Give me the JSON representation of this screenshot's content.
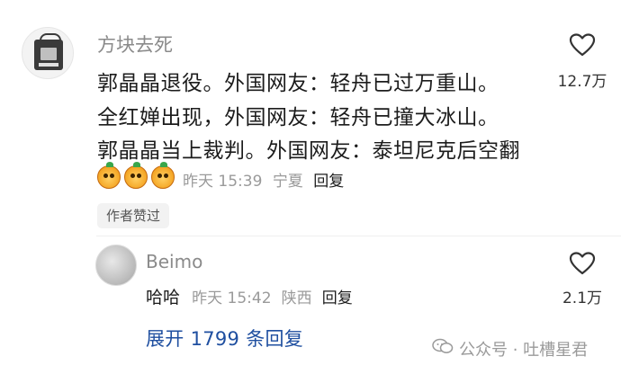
{
  "comment": {
    "username": "方块去死",
    "lines": [
      "郭晶晶退役。外国网友：轻舟已过万重山。",
      "全红婵出现，外国网友：轻舟已撞大冰山。",
      "郭晶晶当上裁判。外国网友：泰坦尼克后空翻"
    ],
    "time": "昨天 15:39",
    "location": "宁夏",
    "reply_label": "回复",
    "like_count": "12.7万",
    "author_badge": "作者赞过",
    "emojis": [
      "cute-face",
      "cute-face",
      "cute-face"
    ]
  },
  "sub_reply": {
    "username": "Beimo",
    "text": "哈哈",
    "time": "昨天 15:42",
    "location": "陕西",
    "reply_label": "回复",
    "like_count": "2.1万"
  },
  "expand_label": "展开 1799 条回复",
  "watermark": "公众号 · 吐槽星君"
}
